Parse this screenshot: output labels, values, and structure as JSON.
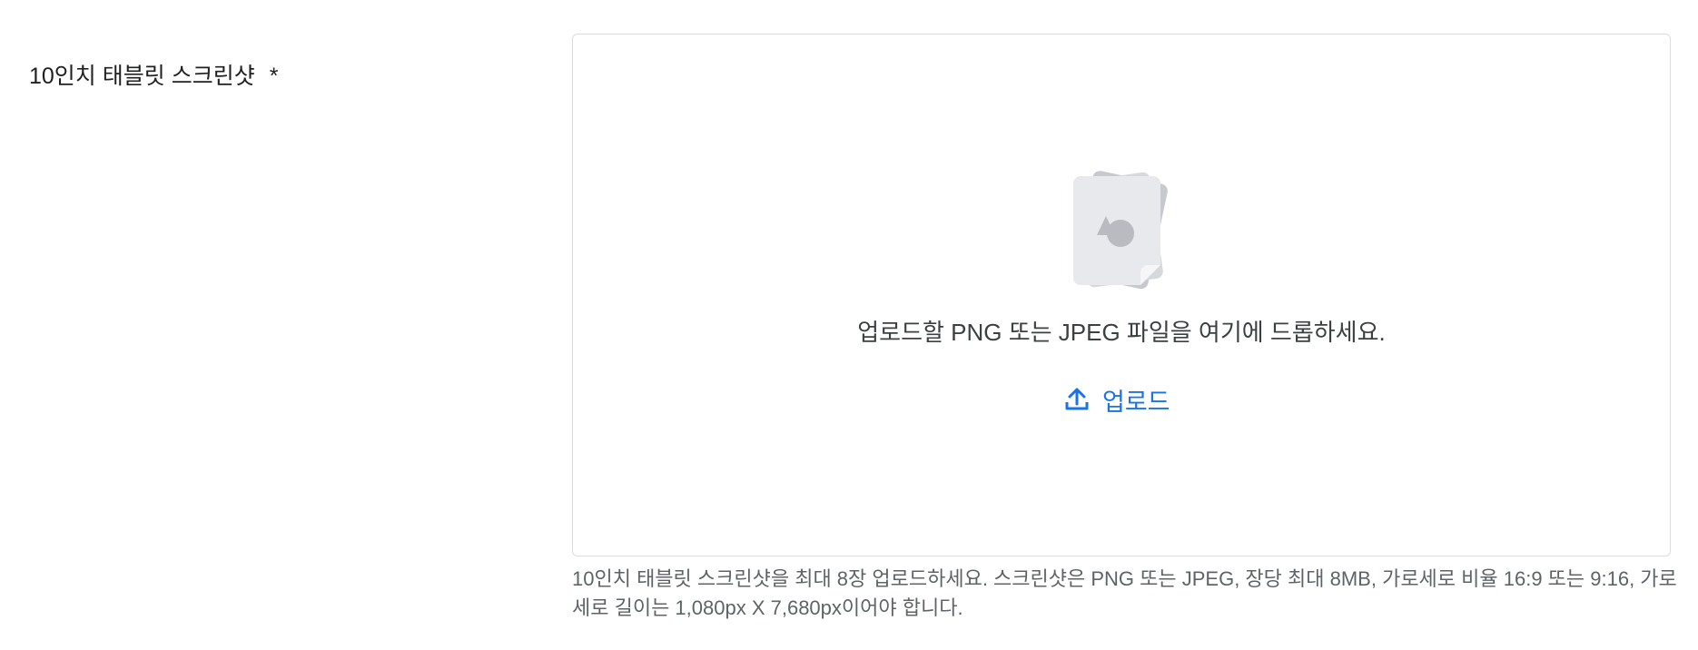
{
  "field": {
    "label": "10인치 태블릿 스크린샷",
    "required_mark": "*"
  },
  "dropzone": {
    "icon": "image-file-stack-icon",
    "drop_text": "업로드할 PNG 또는 JPEG 파일을 여기에 드롭하세요.",
    "upload_icon": "upload-arrow-icon",
    "upload_label": "업로드"
  },
  "helper_text": "10인치 태블릿 스크린샷을 최대 8장 업로드하세요. 스크린샷은 PNG 또는 JPEG, 장당 최대 8MB, 가로세로 비율 16:9 또는 9:16, 가로세로 길이는 1,080px X 7,680px이어야 합니다.",
  "colors": {
    "accent": "#1a73e8",
    "text": "#202124",
    "muted": "#5f6368",
    "border": "#dadce0"
  }
}
